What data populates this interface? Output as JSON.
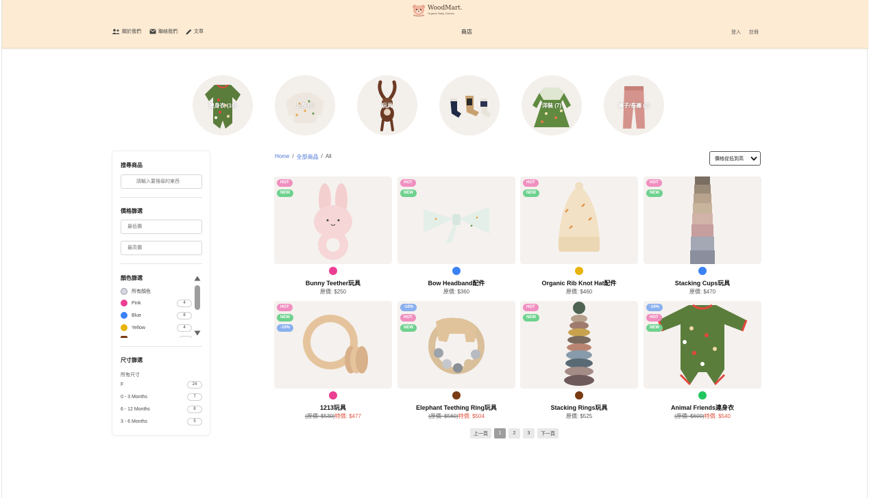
{
  "header": {
    "logo_name": "WoodMart.",
    "logo_sub": "Organic Baby Clothes",
    "nav_left": [
      {
        "label": "關於我們",
        "icon": "people-icon"
      },
      {
        "label": "聯絡我們",
        "icon": "mail-icon"
      },
      {
        "label": "文章",
        "icon": "pencil-icon"
      }
    ],
    "nav_center": "商店",
    "nav_right": [
      "登入",
      "註冊"
    ]
  },
  "categories": [
    {
      "label": "連身衣 (10)",
      "image": "romper"
    },
    {
      "label": "上衣 (5)",
      "image": "sweater"
    },
    {
      "label": "玩具",
      "image": "bunny-toy"
    },
    {
      "label": "",
      "image": "socks"
    },
    {
      "label": "洋裝 (7)",
      "image": "dress"
    },
    {
      "label": "褲子/長褲 (2)",
      "image": "pants"
    }
  ],
  "sidebar": {
    "search_title": "搜尋商品",
    "search_placeholder": "請輸入要搜尋的東西",
    "price_title": "價格篩選",
    "min_placeholder": "最低價",
    "max_placeholder": "最高價",
    "color_title": "顏色篩選",
    "colors": [
      {
        "label": "所有顏色",
        "hex": "#d8d8e0",
        "count": ""
      },
      {
        "label": "Pink",
        "hex": "#ec3f93",
        "count": "4"
      },
      {
        "label": "Blue",
        "hex": "#3b82f6",
        "count": "8"
      },
      {
        "label": "Yellow",
        "hex": "#e8b30a",
        "count": "4"
      }
    ],
    "size_title": "尺寸篩選",
    "size_all": "所有尺寸",
    "sizes": [
      {
        "label": "F",
        "count": "24"
      },
      {
        "label": "0 - 3 Months",
        "count": "7"
      },
      {
        "label": "6 - 12 Months",
        "count": "8"
      },
      {
        "label": "3 - 6 Months",
        "count": "5"
      }
    ]
  },
  "breadcrumb": {
    "home": "Home",
    "all_products": "全部商品",
    "current": "All"
  },
  "sort": {
    "selected": "價格從低到高"
  },
  "products": [
    {
      "name": "Bunny Teether玩具",
      "price": "原價: $250",
      "orig": "",
      "sale": "",
      "badges": [
        "HOT",
        "NEW"
      ],
      "swatch": "#ec3f93",
      "image": "bunny"
    },
    {
      "name": "Bow Headband配件",
      "price": "原價: $360",
      "orig": "",
      "sale": "",
      "badges": [
        "HOT",
        "NEW"
      ],
      "swatch": "#3b82f6",
      "image": "bow"
    },
    {
      "name": "Organic Rib Knot Hat配件",
      "price": "原價: $460",
      "orig": "",
      "sale": "",
      "badges": [
        "HOT",
        "NEW"
      ],
      "swatch": "#e8b30a",
      "image": "hat"
    },
    {
      "name": "Stacking Cups玩具",
      "price": "原價: $470",
      "orig": "",
      "sale": "",
      "badges": [
        "HOT",
        "NEW"
      ],
      "swatch": "#3b82f6",
      "image": "cups"
    },
    {
      "name": "1213玩具",
      "price": "",
      "orig": "(原價: $530)",
      "sale": "特價: $477",
      "badges": [
        "HOT",
        "NEW",
        "-10%"
      ],
      "swatch": "#ec3f93",
      "image": "rattle"
    },
    {
      "name": "Elephant Teething Ring玩具",
      "price": "",
      "orig": "(原價: $560)",
      "sale": "特價: $504",
      "badges": [
        "-10%",
        "HOT",
        "NEW"
      ],
      "swatch": "#7a3a12",
      "image": "elephant"
    },
    {
      "name": "Stacking Rings玩具",
      "price": "原價: $525",
      "orig": "",
      "sale": "",
      "badges": [
        "HOT",
        "NEW"
      ],
      "swatch": "#7a3a12",
      "image": "rings"
    },
    {
      "name": "Animal Friends連身衣",
      "price": "",
      "orig": "(原價: $600)",
      "sale": "特價: $540",
      "badges": [
        "-10%",
        "HOT",
        "NEW"
      ],
      "swatch": "#22c55e",
      "image": "romper"
    }
  ],
  "pagination": {
    "prev": "上一頁",
    "pages": [
      "1",
      "2",
      "3"
    ],
    "current": "1",
    "next": "下一頁"
  }
}
